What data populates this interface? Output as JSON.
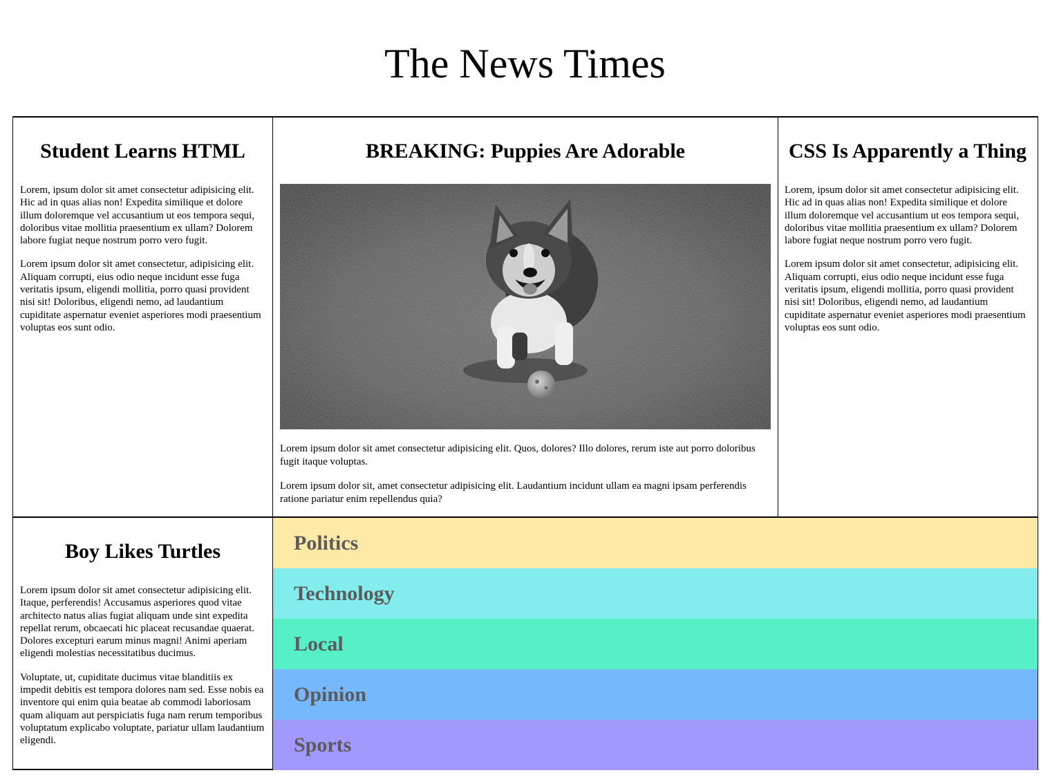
{
  "masthead": {
    "title": "The News Times"
  },
  "articles": {
    "html": {
      "headline": "Student Learns HTML",
      "paragraphs": [
        "Lorem, ipsum dolor sit amet consectetur adipisicing elit. Hic ad in quas alias non! Expedita similique et dolore illum doloremque vel accusantium ut eos tempora sequi, doloribus vitae mollitia praesentium ex ullam? Dolorem labore fugiat neque nostrum porro vero fugit.",
        "Lorem ipsum dolor sit amet consectetur, adipisicing elit. Aliquam corrupti, eius odio neque incidunt esse fuga veritatis ipsum, eligendi mollitia, porro quasi provident nisi sit! Doloribus, eligendi nemo, ad laudantium cupiditate aspernatur eveniet asperiores modi praesentium voluptas eos sunt odio."
      ]
    },
    "puppies": {
      "headline": "BREAKING: Puppies Are Adorable",
      "image": "corgi-photo",
      "paragraphs": [
        "Lorem ipsum dolor sit amet consectetur adipisicing elit. Quos, dolores? Illo dolores, rerum iste aut porro doloribus fugit itaque voluptas.",
        "Lorem ipsum dolor sit, amet consectetur adipisicing elit. Laudantium incidunt ullam ea magni ipsam perferendis ratione pariatur enim repellendus quia?"
      ]
    },
    "css": {
      "headline": "CSS Is Apparently a Thing",
      "paragraphs": [
        "Lorem, ipsum dolor sit amet consectetur adipisicing elit. Hic ad in quas alias non! Expedita similique et dolore illum doloremque vel accusantium ut eos tempora sequi, doloribus vitae mollitia praesentium ex ullam? Dolorem labore fugiat neque nostrum porro vero fugit.",
        "Lorem ipsum dolor sit amet consectetur, adipisicing elit. Aliquam corrupti, eius odio neque incidunt esse fuga veritatis ipsum, eligendi mollitia, porro quasi provident nisi sit! Doloribus, eligendi nemo, ad laudantium cupiditate aspernatur eveniet asperiores modi praesentium voluptas eos sunt odio."
      ]
    },
    "turtles": {
      "headline": "Boy Likes Turtles",
      "paragraphs": [
        "Lorem ipsum dolor sit amet consectetur adipisicing elit. Itaque, perferendis! Accusamus asperiores quod vitae architecto natus alias fugiat aliquam unde sint expedita repellat rerum, obcaecati hic placeat recusandae quaerat. Dolores excepturi earum minus magni! Animi aperiam eligendi molestias necessitatibus ducimus.",
        "Voluptate, ut, cupiditate ducimus vitae blanditiis ex impedit debitis est tempora dolores nam sed. Esse nobis ea inventore qui enim quia beatae ab commodi laboriosam quam aliquam aut perspiciatis fuga nam rerum temporibus voluptatum explicabo voluptate, pariatur ullam laudantium eligendi."
      ]
    }
  },
  "sections": [
    {
      "label": "Politics",
      "color": "#ffe9a6"
    },
    {
      "label": "Technology",
      "color": "#83eded"
    },
    {
      "label": "Local",
      "color": "#55f0c6"
    },
    {
      "label": "Opinion",
      "color": "#75b8fc"
    },
    {
      "label": "Sports",
      "color": "#a199fc"
    }
  ]
}
